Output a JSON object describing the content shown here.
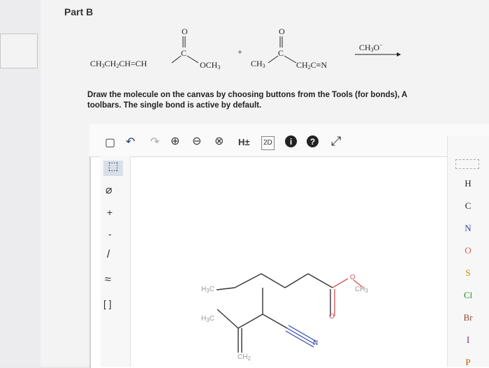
{
  "page": {
    "part_title": "Part B",
    "instructions_line1": "Draw the molecule on the canvas by choosing buttons from the Tools (for bonds), A",
    "instructions_line2": "toolbars. The single bond is active by default."
  },
  "reaction": {
    "reactant1_chain": "CH3CH2CH=CH",
    "reactant1_carbonyl_o": "O",
    "reactant1_carbonyl_c": "C",
    "reactant1_ester": "OCH3",
    "plus": "+",
    "reactant2_methyl": "CH3",
    "reactant2_carbonyl_o": "O",
    "reactant2_carbonyl_c": "C",
    "reactant2_nitrile": "CH2C≡N",
    "reagent": "CH3O⁻"
  },
  "toolbar": {
    "new": "▢",
    "undo": "↶",
    "redo": "↷",
    "zoom_in": "⊕",
    "zoom_out": "⊖",
    "reset_zoom": "⊗",
    "hydrogens": "H±",
    "two_d": "2D",
    "info": "i",
    "help": "?",
    "expand": "⤢"
  },
  "left_tools": {
    "select": "⬚",
    "erase": "⌀",
    "plus_charge": "+",
    "minus_charge": "-",
    "bond": "/",
    "chain": "≈",
    "template": "[ ]"
  },
  "elements": [
    "H",
    "C",
    "N",
    "O",
    "S",
    "Cl",
    "Br",
    "I",
    "P"
  ],
  "canvas": {
    "labels": {
      "h3c_top": "H3C",
      "h3c_bottom": "H3C",
      "ch3_right": "CH3",
      "ch2_bottom": "CH2",
      "o_single": "O",
      "o_double": "O",
      "n_nitrile": "N"
    }
  },
  "colors": {
    "oxygen": "#d55a5a",
    "nitrogen": "#3344aa",
    "sulfur": "#c48d00",
    "chlorine": "#2a8a2a",
    "bromine": "#8a4a2a",
    "iodine": "#7a2aa0"
  }
}
